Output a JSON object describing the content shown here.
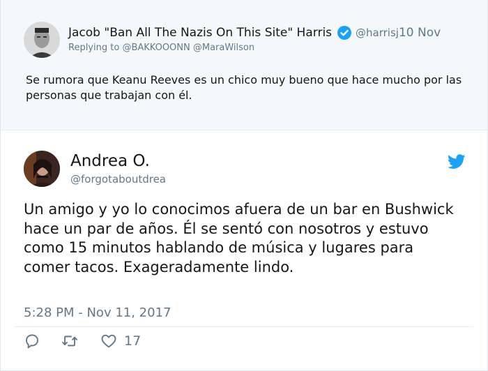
{
  "parent_tweet": {
    "author_name": "Jacob \"Ban All The Nazis On This Site\" Harris",
    "handle": "@harrisj",
    "date": "10 Nov",
    "replying_to_prefix": "Replying to",
    "mentions": "@BAKKOOONN @MaraWilson",
    "text": "Se rumora que Keanu Reeves es un chico muy bueno que hace mucho por las personas que trabajan con él."
  },
  "main_tweet": {
    "author_name": "Andrea O.",
    "handle": "@forgotaboutdrea",
    "text": "Un amigo y yo lo conocimos afuera de un bar en Bushwick hace un par de años. Él se sentó con nosotros y estuvo como 15 minutos hablando de música y lugares para comer tacos. Exageradamente lindo.",
    "timestamp": "5:28 PM - Nov 11, 2017",
    "like_count": "17"
  },
  "icons": {
    "verified": "verified-badge-icon",
    "twitter": "twitter-bird-icon",
    "reply": "reply-icon",
    "retweet": "retweet-icon",
    "like": "heart-icon"
  },
  "colors": {
    "accent": "#1da1f2",
    "secondary_text": "#657786",
    "parent_background": "#f5f8fa"
  }
}
